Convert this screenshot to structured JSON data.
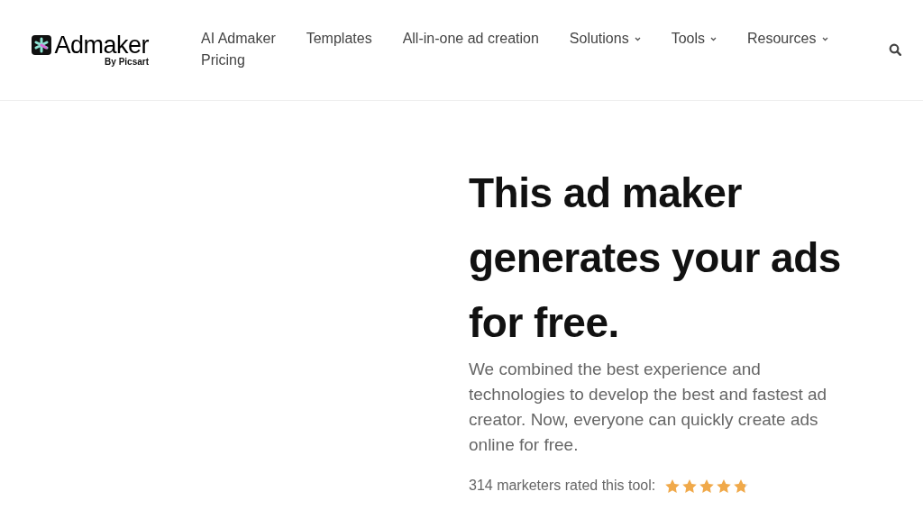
{
  "header": {
    "logo": {
      "name": "Admaker",
      "tagline": "By Picsart"
    },
    "nav": [
      {
        "label": "AI Admaker",
        "dropdown": false
      },
      {
        "label": "Templates",
        "dropdown": false
      },
      {
        "label": "All-in-one ad creation",
        "dropdown": false
      },
      {
        "label": "Solutions",
        "dropdown": true
      },
      {
        "label": "Tools",
        "dropdown": true
      },
      {
        "label": "Resources",
        "dropdown": true
      },
      {
        "label": "Pricing",
        "dropdown": false
      }
    ]
  },
  "hero": {
    "title": "This ad maker generates your ads for free.",
    "description": "We combined the best experience and technologies to develop the best and fastest ad creator. Now, everyone can quickly create ads online for free.",
    "rating": {
      "label": "314 marketers rated this tool:",
      "stars": 4.8
    }
  }
}
